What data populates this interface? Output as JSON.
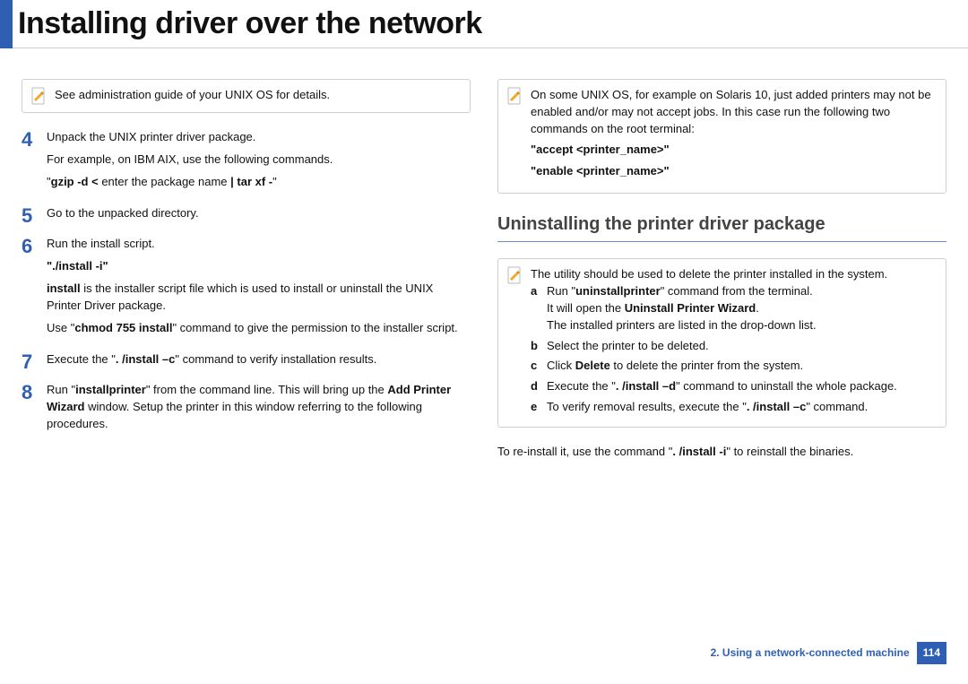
{
  "header": {
    "title": "Installing driver over the network"
  },
  "left": {
    "note": "See administration guide of your UNIX OS for details.",
    "steps": {
      "s4": {
        "line1": "Unpack the UNIX printer driver package.",
        "line2": "For example, on IBM AIX, use the following commands.",
        "cmd_pre": "\"",
        "cmd_b1": "gzip -d <",
        "cmd_mid": " enter the package name ",
        "cmd_b2": "| tar xf -",
        "cmd_post": "\""
      },
      "s5": {
        "line1": "Go to the unpacked directory."
      },
      "s6": {
        "line1": "Run the install script.",
        "cmd": "\"./install -i\"",
        "desc_b": "install",
        "desc_rest": " is the installer script file which is used to install or uninstall the UNIX Printer Driver package.",
        "perm_pre": "Use \"",
        "perm_b": "chmod 755 install",
        "perm_post": "\" command to give the permission to the installer script."
      },
      "s7": {
        "pre": "Execute the \"",
        "b": ". /install –c",
        "post": "\" command to verify installation results."
      },
      "s8": {
        "pre": "Run \"",
        "b1": "installprinter",
        "mid": "\" from the command line. This will bring up the ",
        "b2": "Add Printer Wizard",
        "post": " window. Setup the printer in this window referring to the following procedures."
      }
    }
  },
  "right": {
    "note1": {
      "text": "On some UNIX OS, for example on Solaris 10, just added printers may not be enabled and/or may not accept jobs. In this case run the following two commands on the root terminal:",
      "cmd1": "\"accept <printer_name>\"",
      "cmd2": "\"enable <printer_name>\""
    },
    "subhead": "Uninstalling the printer driver package",
    "note2": {
      "intro": "The utility should be used to delete the printer installed in the system.",
      "a_pre": "Run \"",
      "a_b": "uninstallprinter",
      "a_post": "\" command from the terminal.",
      "a2_pre": "It will open the ",
      "a2_b": "Uninstall Printer Wizard",
      "a2_post": ".",
      "a3": "The installed printers are listed in the drop-down list.",
      "b": "Select the printer to be deleted.",
      "c_pre": "Click ",
      "c_b": "Delete",
      "c_post": " to delete the printer from the system.",
      "d_pre": "Execute the \"",
      "d_b": ". /install –d",
      "d_post": "\" command to uninstall the whole package.",
      "e_pre": "To verify removal results, execute the \"",
      "e_b": ". /install –c",
      "e_post": "\" command."
    },
    "reinstall_pre": "To re-install it, use the command \"",
    "reinstall_b": ". /install -i",
    "reinstall_post": "\" to reinstall the binaries."
  },
  "footer": {
    "chapter": "2.  Using a network-connected machine",
    "page": "114"
  }
}
